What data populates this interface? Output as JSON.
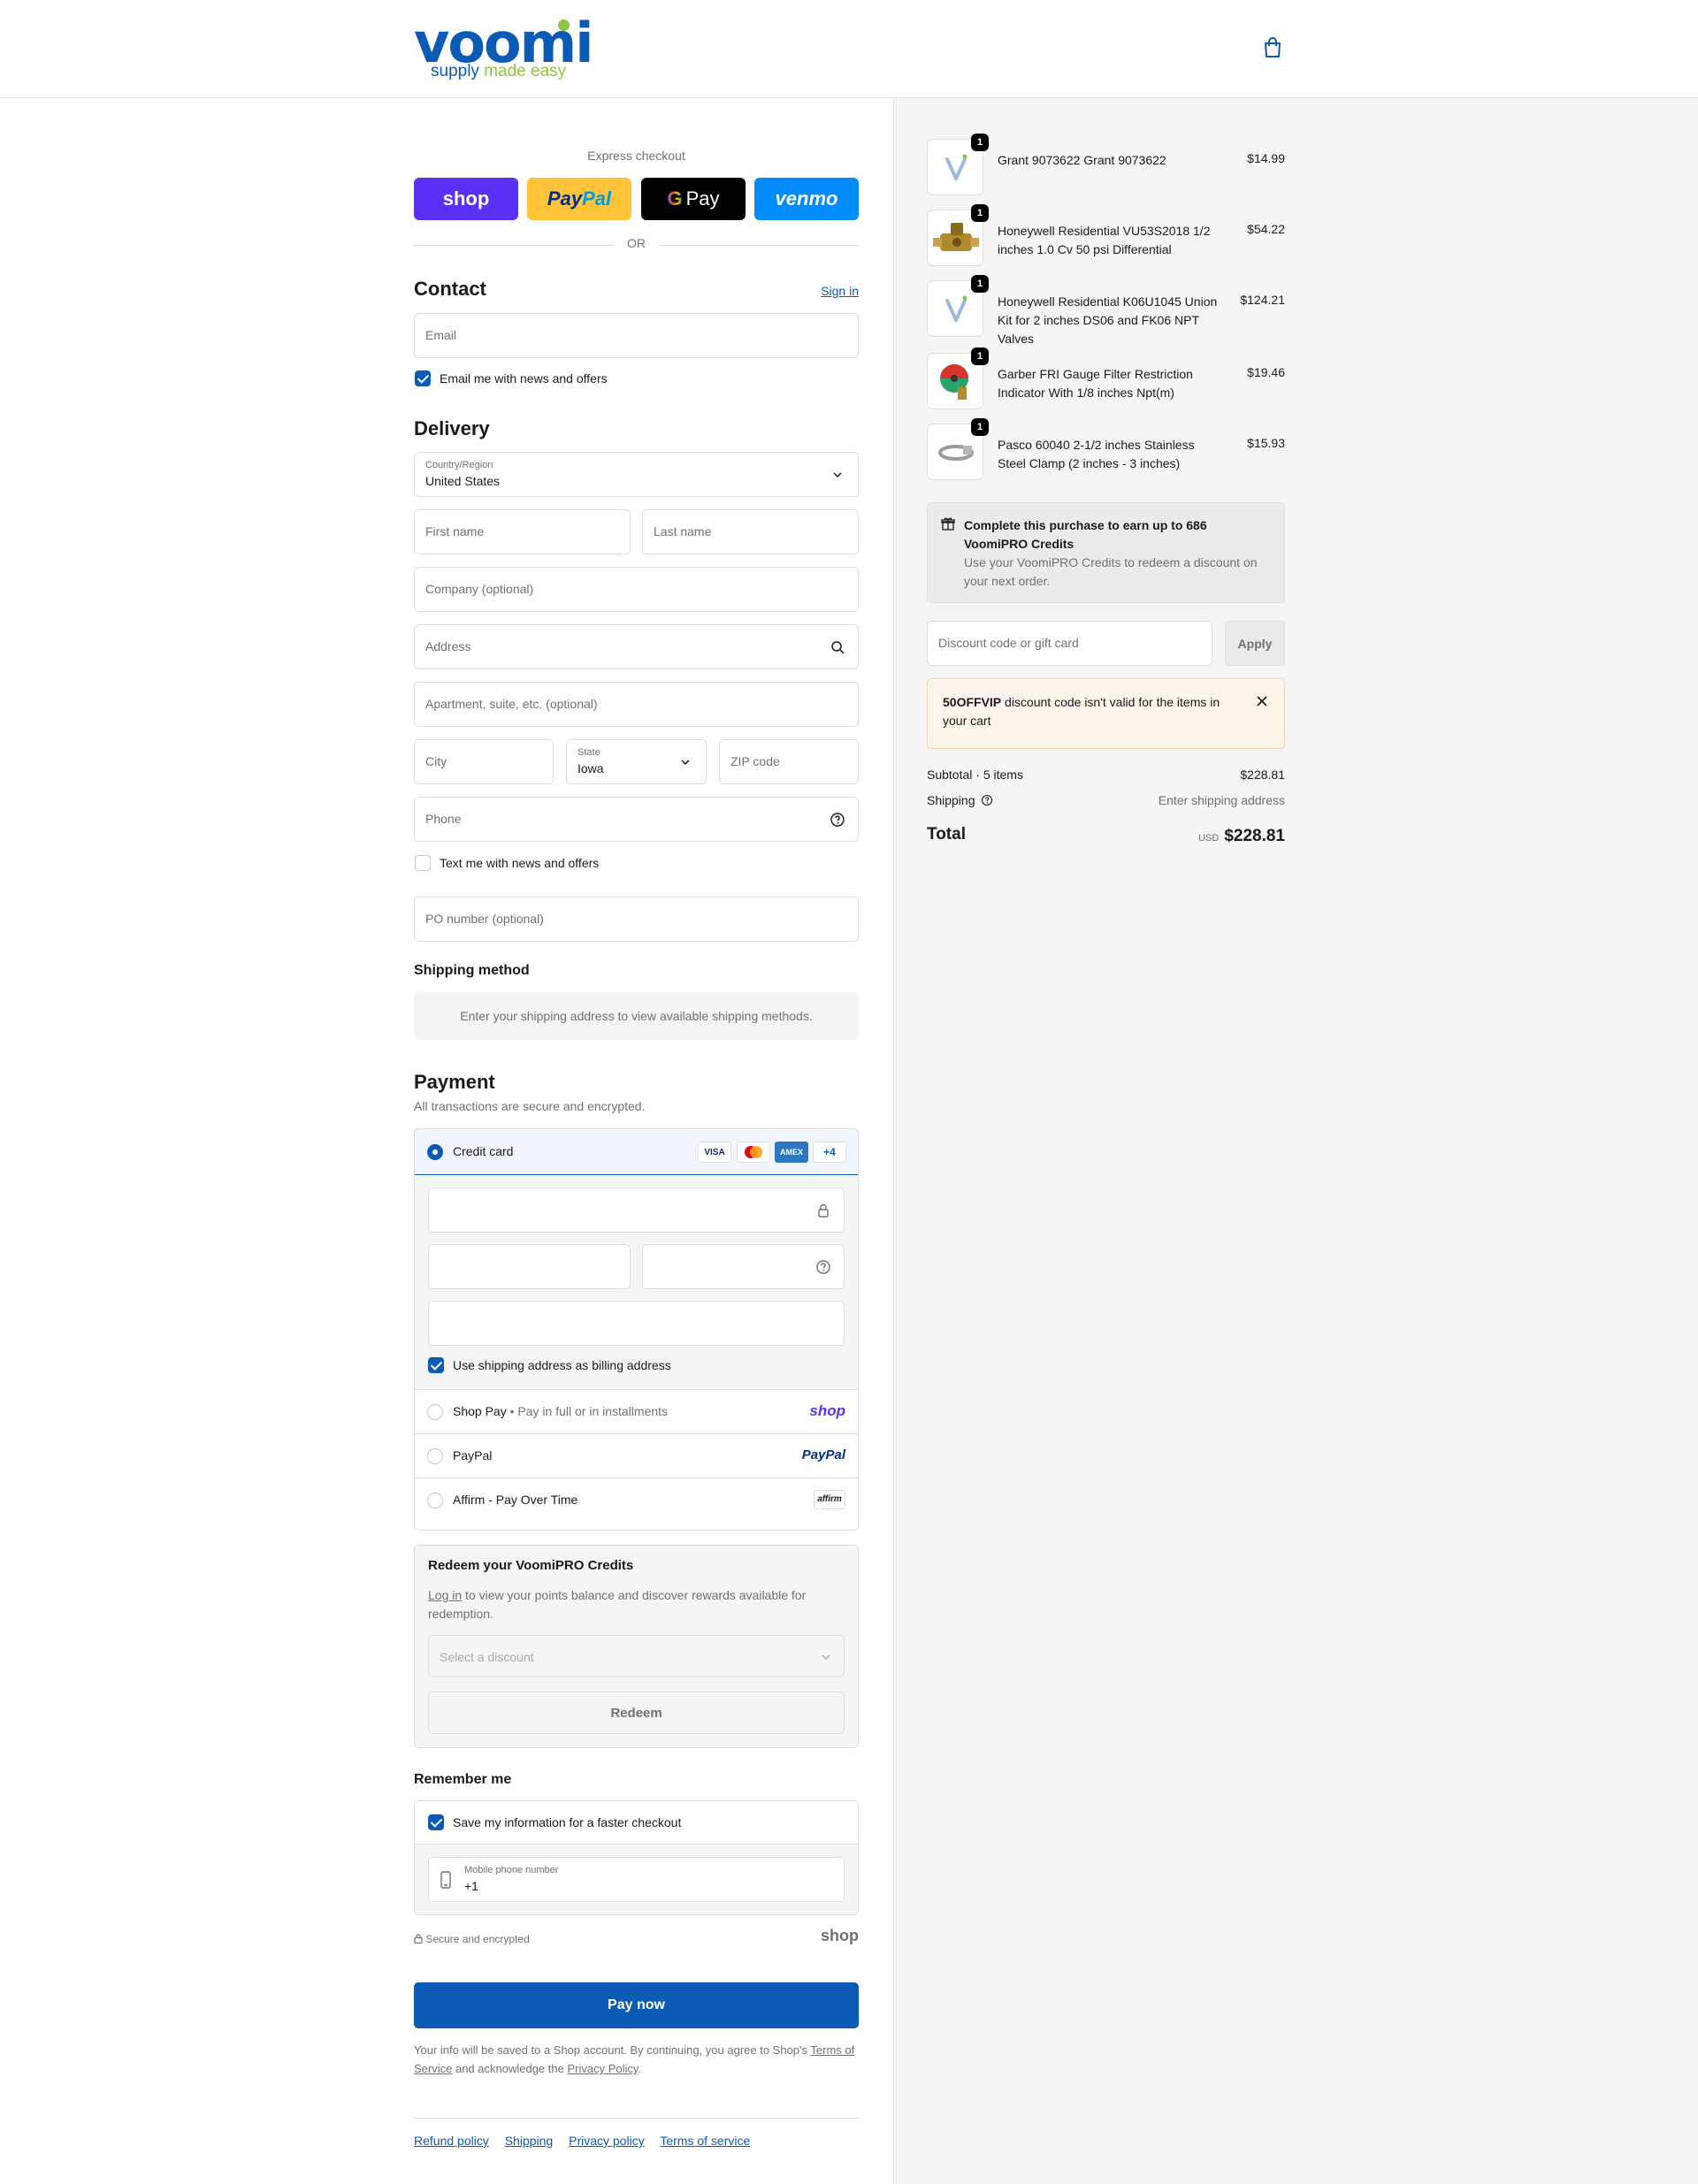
{
  "header": {
    "logo_text": "voomi",
    "logo_tagline_part1": "supply ",
    "logo_tagline_part2": "made easy",
    "cart_icon": "shopping-bag-icon"
  },
  "express": {
    "label": "Express checkout",
    "shop_label": "shop",
    "paypal_label_a": "Pay",
    "paypal_label_b": "Pal",
    "gpay_g": "G",
    "gpay_label": "Pay",
    "venmo_label": "venmo",
    "or_label": "OR"
  },
  "contact": {
    "heading": "Contact",
    "sign_in": "Sign in",
    "email_placeholder": "Email",
    "news_label": "Email me with news and offers",
    "news_checked": true
  },
  "delivery": {
    "heading": "Delivery",
    "country_label": "Country/Region",
    "country_value": "United States",
    "first_name": "First name",
    "last_name": "Last name",
    "company": "Company (optional)",
    "address": "Address",
    "apartment": "Apartment, suite, etc. (optional)",
    "city": "City",
    "state_label": "State",
    "state_value": "Iowa",
    "zip": "ZIP code",
    "phone": "Phone",
    "text_label": "Text me with news and offers",
    "text_checked": false,
    "po_number": "PO number (optional)"
  },
  "shipping": {
    "heading": "Shipping method",
    "message": "Enter your shipping address to view available shipping methods."
  },
  "payment": {
    "heading": "Payment",
    "subtitle": "All transactions are secure and encrypted.",
    "credit_card_label": "Credit card",
    "card_visa": "VISA",
    "card_amex": "AMEX",
    "card_more": "+4",
    "billing_label": "Use shipping address as billing address",
    "billing_checked": true,
    "shop_pay_label": "Shop Pay",
    "shop_pay_sub": "Pay in full or in installments",
    "shop_pay_logo": "shop",
    "paypal_label": "PayPal",
    "paypal_logo": "PayPal",
    "affirm_label": "Affirm - Pay Over Time",
    "affirm_logo": "affirm"
  },
  "redeem": {
    "heading": "Redeem your VoomiPRO Credits",
    "login_link": "Log in",
    "login_text": " to view your points balance and discover rewards available for redemption.",
    "select_placeholder": "Select a discount",
    "button": "Redeem"
  },
  "remember": {
    "heading": "Remember me",
    "save_label": "Save my information for a faster checkout",
    "save_checked": true,
    "phone_label": "Mobile phone number",
    "phone_value": "+1",
    "secure_label": "Secure and encrypted",
    "shop_logo": "shop"
  },
  "pay_now": "Pay now",
  "consent": {
    "text1": "Your info will be saved to a Shop account. By continuing, you agree to Shop's ",
    "tos": "Terms of Service",
    "text2": " and acknowledge the ",
    "privacy": "Privacy Policy",
    "text3": "."
  },
  "footer_links": [
    "Refund policy",
    "Shipping",
    "Privacy policy",
    "Terms of service"
  ],
  "cart": {
    "items": [
      {
        "name": "Grant 9073622 Grant 9073622",
        "price": "$14.99",
        "qty": "1",
        "thumb": "voomi-placeholder"
      },
      {
        "name": "Honeywell Residential VU53S2018 1/2 inches 1.0 Cv 50 psi Differential",
        "price": "$54.22",
        "qty": "1",
        "thumb": "brass-valve"
      },
      {
        "name": "Honeywell Residential K06U1045 Union Kit for 2 inches DS06 and FK06 NPT Valves",
        "price": "$124.21",
        "qty": "1",
        "thumb": "voomi-placeholder"
      },
      {
        "name": "Garber FRI Gauge Filter Restriction Indicator With 1/8 inches Npt(m)",
        "price": "$19.46",
        "qty": "1",
        "thumb": "gauge"
      },
      {
        "name": "Pasco 60040 2-1/2 inches Stainless Steel Clamp (2 inches - 3 inches)",
        "price": "$15.93",
        "qty": "1",
        "thumb": "clamp"
      }
    ],
    "credits_title": "Complete this purchase to earn up to 686 VoomiPRO Credits",
    "credits_text": "Use your VoomiPRO Credits to redeem a discount on your next order.",
    "discount_placeholder": "Discount code or gift card",
    "apply": "Apply",
    "warning_code": "50OFFVIP",
    "warning_text": " discount code isn't valid for the items in your cart",
    "subtotal_label": "Subtotal · 5 items",
    "subtotal_value": "$228.81",
    "shipping_label": "Shipping",
    "shipping_value": "Enter shipping address",
    "total_label": "Total",
    "currency": "USD",
    "total_value": "$228.81"
  }
}
